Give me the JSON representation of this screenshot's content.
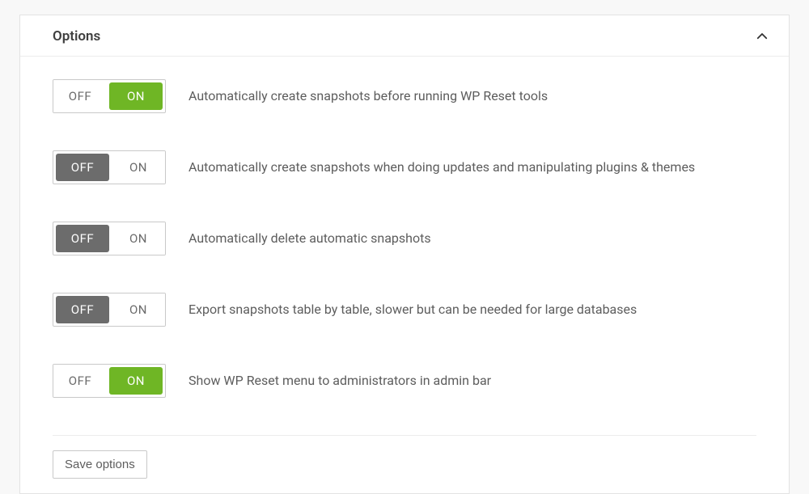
{
  "panel": {
    "title": "Options",
    "collapsed": false
  },
  "toggle_labels": {
    "off": "OFF",
    "on": "ON"
  },
  "options": [
    {
      "id": "auto-snapshot-before-tools",
      "label": "Automatically create snapshots before running WP Reset tools",
      "value": "on"
    },
    {
      "id": "auto-snapshot-on-updates",
      "label": "Automatically create snapshots when doing updates and manipulating plugins & themes",
      "value": "off"
    },
    {
      "id": "auto-delete-snapshots",
      "label": "Automatically delete automatic snapshots",
      "value": "off"
    },
    {
      "id": "export-table-by-table",
      "label": "Export snapshots table by table, slower but can be needed for large databases",
      "value": "off"
    },
    {
      "id": "show-admin-bar-menu",
      "label": "Show WP Reset menu to administrators in admin bar",
      "value": "on"
    }
  ],
  "actions": {
    "save": "Save options"
  },
  "colors": {
    "on": "#6fb625",
    "off": "#6c6c6c",
    "border": "#c9c9c9",
    "text": "#5d5d5d"
  }
}
